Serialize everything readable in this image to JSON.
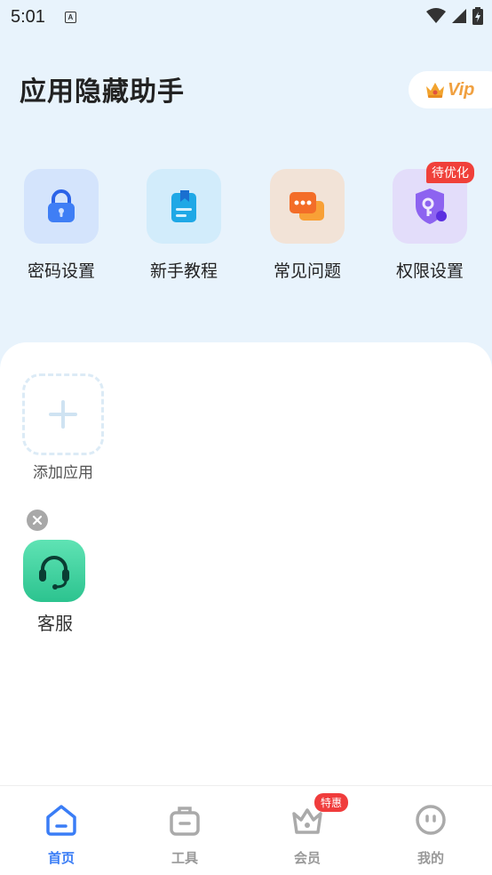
{
  "status": {
    "time": "5:01",
    "notif_icon": "A"
  },
  "header": {
    "title": "应用隐藏助手",
    "vip_label": "Vip"
  },
  "quick_actions": [
    {
      "label": "密码设置",
      "icon": "lock-icon",
      "bg": "#d4e4fc"
    },
    {
      "label": "新手教程",
      "icon": "book-icon",
      "bg": "#d2ecfb"
    },
    {
      "label": "常见问题",
      "icon": "chat-icon",
      "bg": "#f2e3d7"
    },
    {
      "label": "权限设置",
      "icon": "shield-key-icon",
      "bg": "#e3ddfa",
      "badge": "待优化"
    }
  ],
  "apps": {
    "add_label": "添加应用",
    "service_label": "客服"
  },
  "nav": [
    {
      "label": "首页",
      "icon": "home-icon",
      "active": true
    },
    {
      "label": "工具",
      "icon": "toolbox-icon",
      "active": false
    },
    {
      "label": "会员",
      "icon": "crown-icon",
      "active": false,
      "badge": "特惠"
    },
    {
      "label": "我的",
      "icon": "face-icon",
      "active": false
    }
  ],
  "colors": {
    "accent": "#3a7df6",
    "badge": "#f0403a",
    "bg": "#e8f3fc"
  }
}
